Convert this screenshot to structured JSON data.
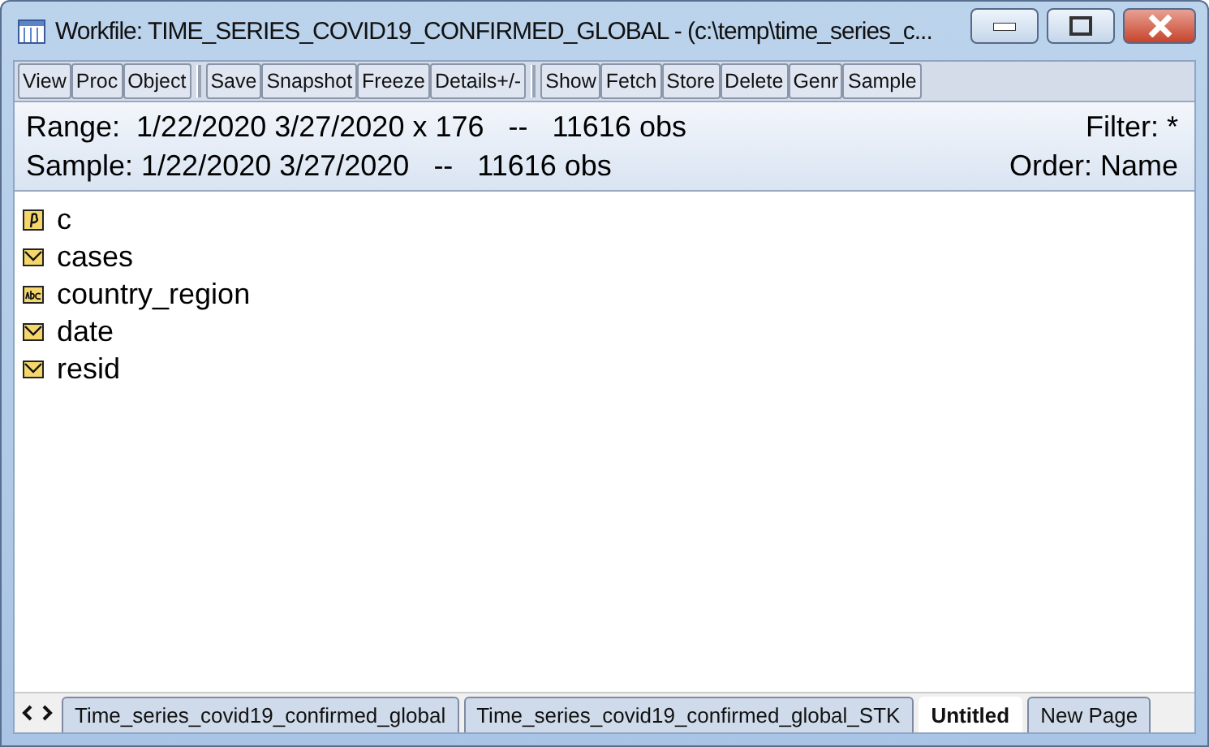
{
  "window": {
    "title": "Workfile: TIME_SERIES_COVID19_CONFIRMED_GLOBAL - (c:\\temp\\time_series_c..."
  },
  "toolbar": [
    [
      "View",
      "Proc",
      "Object"
    ],
    [
      "Save",
      "Snapshot",
      "Freeze",
      "Details+/-"
    ],
    [
      "Show",
      "Fetch",
      "Store",
      "Delete",
      "Genr",
      "Sample"
    ]
  ],
  "info": {
    "range": "Range:  1/22/2020 3/27/2020 x 176   --   11616 obs",
    "filter": "Filter: *",
    "sample": "Sample: 1/22/2020 3/27/2020   --   11616 obs",
    "order": "Order: Name"
  },
  "objects": [
    {
      "name": "c",
      "kind": "coef"
    },
    {
      "name": "cases",
      "kind": "series"
    },
    {
      "name": "country_region",
      "kind": "alpha"
    },
    {
      "name": "date",
      "kind": "series"
    },
    {
      "name": "resid",
      "kind": "series"
    }
  ],
  "page_tabs": [
    {
      "label": "Time_series_covid19_confirmed_global",
      "selected": false
    },
    {
      "label": "Time_series_covid19_confirmed_global_STK",
      "selected": false
    },
    {
      "label": "Untitled",
      "selected": true
    },
    {
      "label": "New Page",
      "selected": false
    }
  ]
}
